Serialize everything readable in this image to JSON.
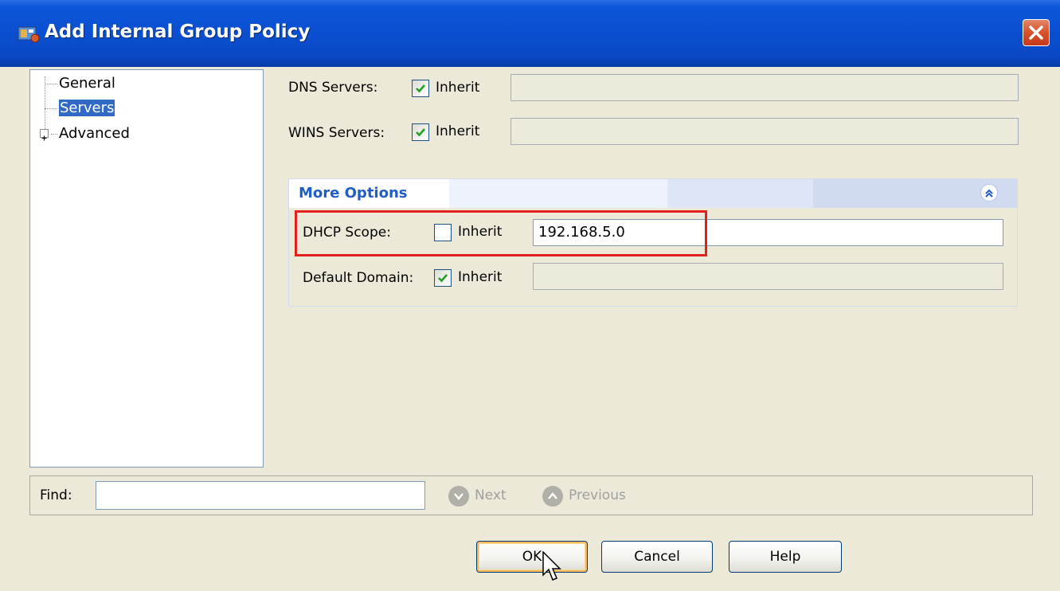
{
  "window": {
    "title": "Add Internal Group Policy",
    "close_icon": "close-icon"
  },
  "tree": {
    "items": [
      {
        "label": "General",
        "selected": false
      },
      {
        "label": "Servers",
        "selected": true
      },
      {
        "label": "Advanced",
        "selected": false,
        "expandable": true
      }
    ]
  },
  "servers": {
    "dns": {
      "label": "DNS Servers:",
      "inherit_label": "Inherit",
      "inherit_checked": true,
      "value": ""
    },
    "wins": {
      "label": "WINS Servers:",
      "inherit_label": "Inherit",
      "inherit_checked": true,
      "value": ""
    }
  },
  "more_options": {
    "title": "More Options",
    "dhcp": {
      "label": "DHCP Scope:",
      "inherit_label": "Inherit",
      "inherit_checked": false,
      "value": "192.168.5.0"
    },
    "domain": {
      "label": "Default Domain:",
      "inherit_label": "Inherit",
      "inherit_checked": true,
      "value": ""
    }
  },
  "find": {
    "label": "Find:",
    "value": "",
    "next_label": "Next",
    "previous_label": "Previous"
  },
  "buttons": {
    "ok": "OK",
    "cancel": "Cancel",
    "help": "Help"
  },
  "colors": {
    "title_bar": "#0a4fd0",
    "highlight_box": "#e3201d",
    "selection": "#316ac5",
    "section_title": "#215dc6"
  }
}
